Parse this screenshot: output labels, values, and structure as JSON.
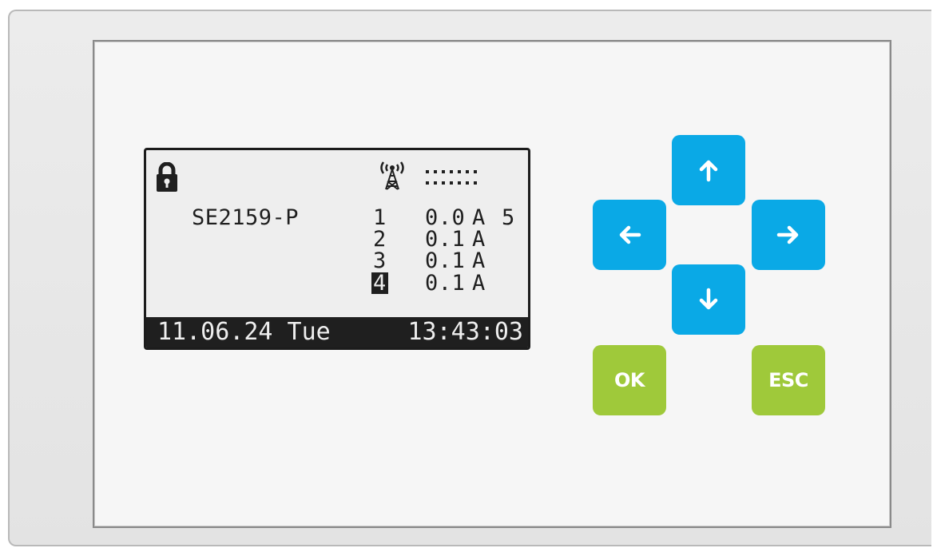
{
  "display": {
    "device_name": "SE2159-P",
    "channel_5_label": "5",
    "channels": [
      {
        "number": "1",
        "current": "0.0",
        "unit": "A",
        "selected": false
      },
      {
        "number": "2",
        "current": "0.1",
        "unit": "A",
        "selected": false
      },
      {
        "number": "3",
        "current": "0.1",
        "unit": "A",
        "selected": false
      },
      {
        "number": "4",
        "current": "0.1",
        "unit": "A",
        "selected": true
      }
    ],
    "status": {
      "date": "11.06.24 Tue",
      "time": "13:43:03"
    },
    "icons": {
      "lock": "lock-icon",
      "antenna": "antenna-icon",
      "signal": "signal-dots-icon"
    }
  },
  "keypad": {
    "up": "arrow-up-icon",
    "left": "arrow-left-icon",
    "right": "arrow-right-icon",
    "down": "arrow-down-icon",
    "ok_label": "OK",
    "esc_label": "ESC"
  },
  "colors": {
    "nav_key": "#0aa9e6",
    "action_key": "#9fc93a",
    "lcd_background": "#eeeeee",
    "lcd_ink": "#1f1f1f"
  }
}
